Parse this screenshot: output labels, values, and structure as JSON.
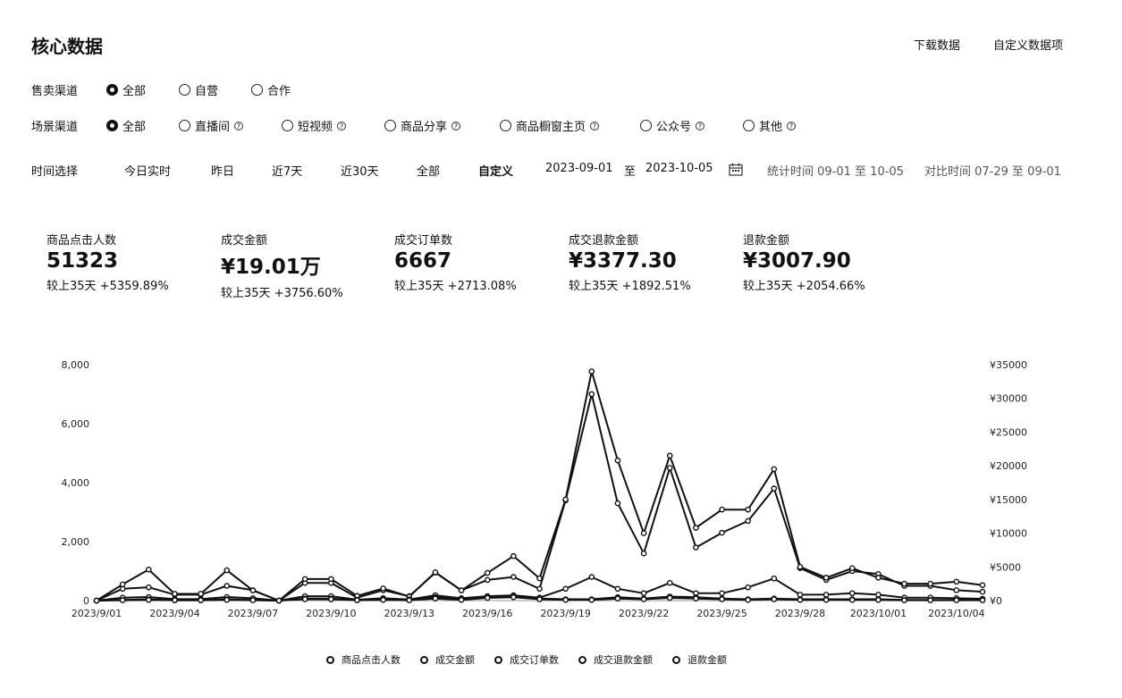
{
  "header": {
    "title": "核心数据",
    "download": "下载数据",
    "custom": "自定义数据项"
  },
  "sale_channel": {
    "label": "售卖渠道",
    "options": [
      "全部",
      "自营",
      "合作"
    ],
    "selected": 0
  },
  "scene_channel": {
    "label": "场景渠道",
    "options": [
      "全部",
      "直播间",
      "短视频",
      "商品分享",
      "商品橱窗主页",
      "公众号",
      "其他"
    ],
    "selected": 0
  },
  "time": {
    "label": "时间选择",
    "options": [
      "今日实时",
      "昨日",
      "近7天",
      "近30天",
      "全部",
      "自定义"
    ],
    "selected": 5,
    "start": "2023-09-01",
    "to": "至",
    "end": "2023-10-05",
    "calendar_icon": "calendar-icon",
    "stat_period": "统计时间 09-01 至 10-05",
    "compare_period": "对比时间 07-29 至 09-01"
  },
  "kpis": [
    {
      "label": "商品点击人数",
      "value": "51323",
      "compare": "较上35天 +5359.89%"
    },
    {
      "label": "成交金额",
      "value": "¥19.01万",
      "compare": "较上35天 +3756.60%"
    },
    {
      "label": "成交订单数",
      "value": "6667",
      "compare": "较上35天 +2713.08%"
    },
    {
      "label": "成交退款金额",
      "value": "¥3377.30",
      "compare": "较上35天 +1892.51%"
    },
    {
      "label": "退款金额",
      "value": "¥3007.90",
      "compare": "较上35天 +2054.66%"
    }
  ],
  "chart_data": {
    "type": "line",
    "x": [
      "2023/9/01",
      "2023/9/02",
      "2023/9/03",
      "2023/9/04",
      "2023/9/05",
      "2023/9/06",
      "2023/9/07",
      "2023/9/08",
      "2023/9/09",
      "2023/9/10",
      "2023/9/11",
      "2023/9/12",
      "2023/9/13",
      "2023/9/14",
      "2023/9/15",
      "2023/9/16",
      "2023/9/17",
      "2023/9/18",
      "2023/9/19",
      "2023/9/20",
      "2023/9/21",
      "2023/9/22",
      "2023/9/23",
      "2023/9/24",
      "2023/9/25",
      "2023/9/26",
      "2023/9/27",
      "2023/9/28",
      "2023/9/29",
      "2023/9/30",
      "2023/10/01",
      "2023/10/02",
      "2023/10/03",
      "2023/10/04",
      "2023/10/05"
    ],
    "x_tick_labels": [
      "2023/9/01",
      "2023/9/04",
      "2023/9/07",
      "2023/9/10",
      "2023/9/13",
      "2023/9/16",
      "2023/9/19",
      "2023/9/22",
      "2023/9/25",
      "2023/9/28",
      "2023/10/01",
      "2023/10/04"
    ],
    "x_tick_indices": [
      0,
      3,
      6,
      9,
      12,
      15,
      18,
      21,
      24,
      27,
      30,
      33
    ],
    "y_left": {
      "ticks": [
        "8,000",
        "6,000",
        "4,000",
        "2,000",
        "0"
      ],
      "range": [
        0,
        8000
      ]
    },
    "y_right": {
      "ticks": [
        "¥35000",
        "¥30000",
        "¥25000",
        "¥20000",
        "¥15000",
        "¥10000",
        "¥5000",
        "¥0"
      ],
      "range": [
        0,
        35000
      ]
    },
    "legend_position": "bottom",
    "series": [
      {
        "name": "商品点击人数",
        "axis": "left",
        "values": [
          0,
          400,
          450,
          200,
          200,
          500,
          350,
          0,
          600,
          600,
          100,
          350,
          150,
          950,
          350,
          700,
          800,
          400,
          3400,
          7000,
          3300,
          1600,
          4500,
          1800,
          2300,
          2700,
          3800,
          1100,
          700,
          1000,
          900,
          500,
          500,
          350,
          300
        ]
      },
      {
        "name": "成交金额",
        "axis": "right",
        "values": [
          0,
          2400,
          4600,
          1000,
          1000,
          4500,
          1500,
          0,
          3200,
          3200,
          700,
          1800,
          600,
          4200,
          1500,
          4100,
          6600,
          3300,
          15000,
          34000,
          20800,
          10000,
          21500,
          10800,
          13500,
          13500,
          19500,
          5000,
          3400,
          4800,
          3400,
          2500,
          2500,
          2800,
          2300
        ]
      },
      {
        "name": "成交订单数",
        "axis": "left",
        "values": [
          0,
          100,
          120,
          50,
          50,
          120,
          80,
          0,
          150,
          150,
          30,
          80,
          40,
          180,
          80,
          150,
          180,
          100,
          400,
          800,
          400,
          250,
          600,
          250,
          250,
          450,
          750,
          200,
          200,
          250,
          200,
          100,
          100,
          80,
          60
        ]
      },
      {
        "name": "成交退款金额",
        "axis": "right",
        "values": [
          0,
          100,
          200,
          50,
          50,
          200,
          100,
          0,
          300,
          300,
          50,
          200,
          100,
          500,
          200,
          600,
          700,
          300,
          200,
          200,
          500,
          300,
          600,
          500,
          300,
          200,
          300,
          200,
          200,
          200,
          200,
          100,
          100,
          100,
          100
        ]
      },
      {
        "name": "退款金额",
        "axis": "right",
        "values": [
          0,
          50,
          100,
          50,
          50,
          100,
          50,
          0,
          200,
          200,
          50,
          100,
          50,
          300,
          100,
          400,
          500,
          200,
          100,
          100,
          300,
          200,
          400,
          300,
          200,
          100,
          200,
          100,
          100,
          100,
          100,
          50,
          50,
          50,
          50
        ]
      }
    ]
  }
}
